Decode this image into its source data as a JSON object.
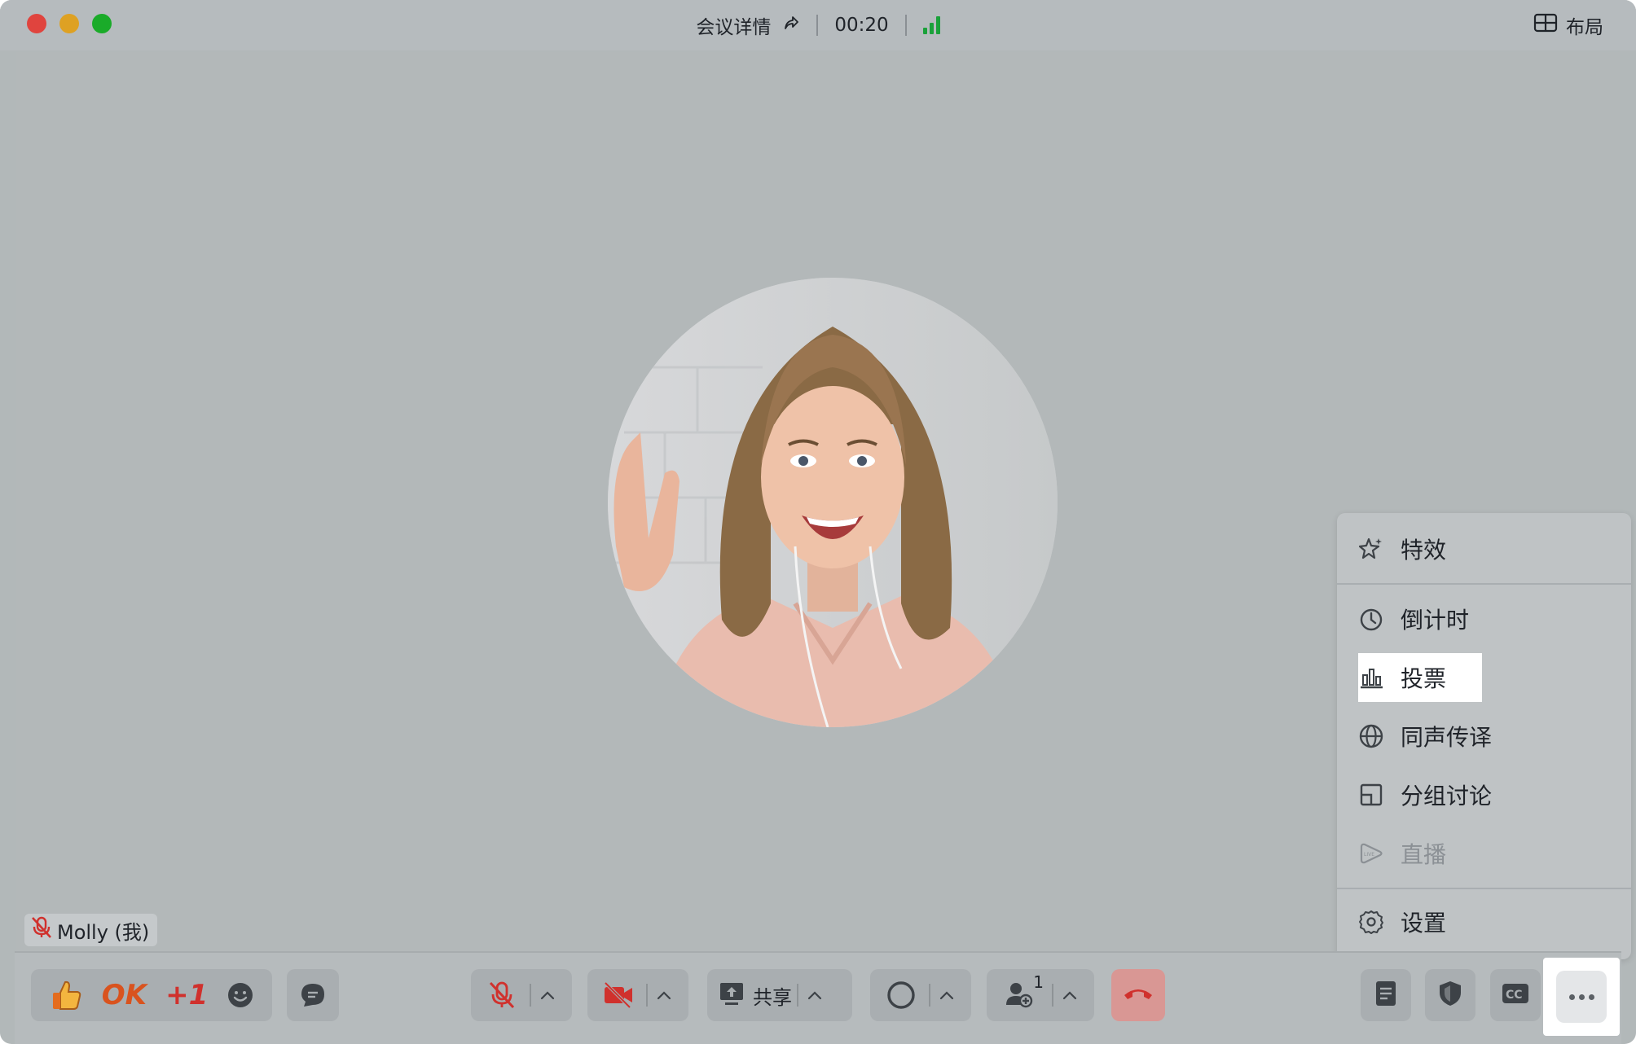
{
  "titlebar": {
    "meeting_title": "会议详情",
    "timer": "00:20",
    "layout_label": "布局"
  },
  "participant": {
    "name": "Molly (我)"
  },
  "toolbar": {
    "reactions": {
      "ok_label": "OK",
      "plus_one_label": "+1"
    },
    "share_label": "共享",
    "participants_count": "1"
  },
  "menu": {
    "items": [
      {
        "label": "特效",
        "icon": "sparkle-star-icon"
      },
      {
        "label": "倒计时",
        "icon": "timer-icon"
      },
      {
        "label": "投票",
        "icon": "bar-chart-icon"
      },
      {
        "label": "同声传译",
        "icon": "globe-icon"
      },
      {
        "label": "分组讨论",
        "icon": "breakout-rooms-icon"
      },
      {
        "label": "直播",
        "icon": "live-icon",
        "disabled": true
      },
      {
        "label": "设置",
        "icon": "gear-icon"
      }
    ]
  },
  "colors": {
    "accent_green": "#1aa13a",
    "danger_red": "#d0312d",
    "reaction_orange": "#d9531e"
  }
}
